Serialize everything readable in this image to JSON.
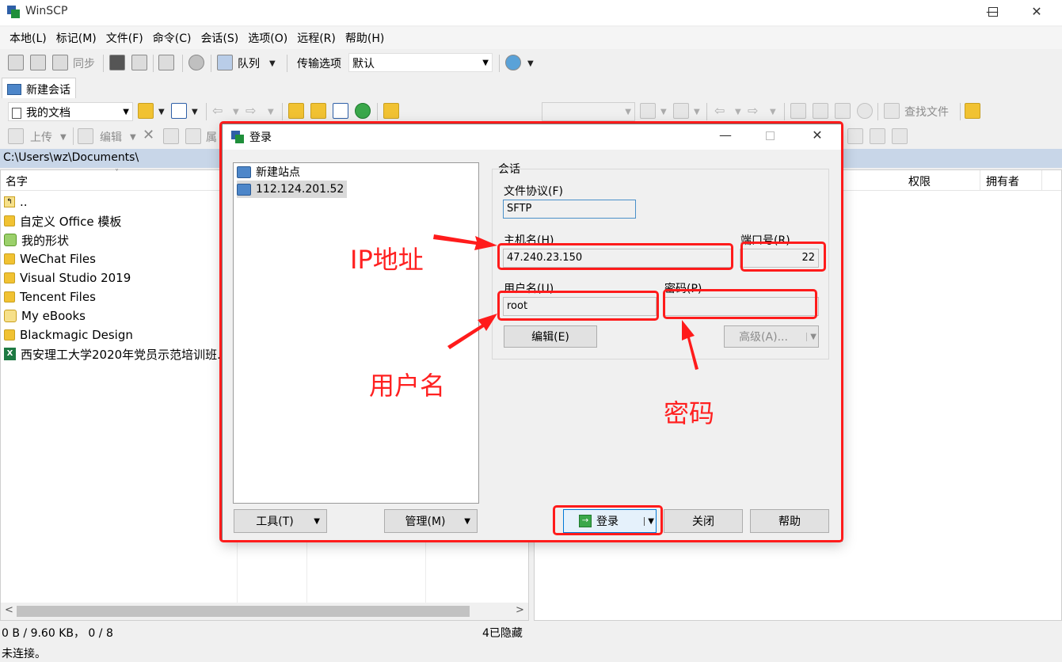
{
  "window": {
    "title": "WinSCP"
  },
  "menu": [
    "本地(L)",
    "标记(M)",
    "文件(F)",
    "命令(C)",
    "会话(S)",
    "选项(O)",
    "远程(R)",
    "帮助(H)"
  ],
  "toolbar": {
    "sync_label": "同步",
    "queue_label": "队列",
    "transfer_label": "传输选项",
    "transfer_value": "默认"
  },
  "tabs": {
    "new_session": "新建会话"
  },
  "left_panel": {
    "location": "我的文档",
    "upload_label": "上传",
    "edit_label": "编辑",
    "attr_label": "属",
    "path": "C:\\Users\\wz\\Documents\\",
    "column_name": "名字",
    "files": [
      "..",
      "自定义 Office 模板",
      "我的形状",
      "WeChat Files",
      "Visual Studio 2019",
      "Tencent Files",
      "My eBooks",
      "Blackmagic Design",
      "西安理工大学2020年党员示范培训班."
    ]
  },
  "right_panel": {
    "find_files": "查找文件",
    "col_rights": "权限",
    "col_owner": "拥有者"
  },
  "status": {
    "left_summary": "0 B / 9.60 KB，  0 / 8",
    "hidden": "4已隐藏",
    "connection": "未连接。"
  },
  "dialog": {
    "title": "登录",
    "sites": [
      "新建站点",
      "112.124.201.52"
    ],
    "tools_button": "工具(T)",
    "manage_button": "管理(M)",
    "session_group": "会话",
    "protocol_label": "文件协议(F)",
    "protocol_value": "SFTP",
    "host_label": "主机名(H)",
    "host_value": "47.240.23.150",
    "port_label": "端口号(R)",
    "port_value": "22",
    "user_label": "用户名(U)",
    "user_value": "root",
    "password_label": "密码(P)",
    "password_value": "",
    "edit_button": "编辑(E)",
    "advanced_button": "高级(A)...",
    "login_button": "登录",
    "close_button": "关闭",
    "help_button": "帮助"
  },
  "annotations": {
    "ip": "IP地址",
    "user": "用户名",
    "password": "密码"
  },
  "colors": {
    "annotation": "#ff1b1b",
    "path_bar": "#c8d6e8",
    "selected_site": "#d9d9d9"
  }
}
